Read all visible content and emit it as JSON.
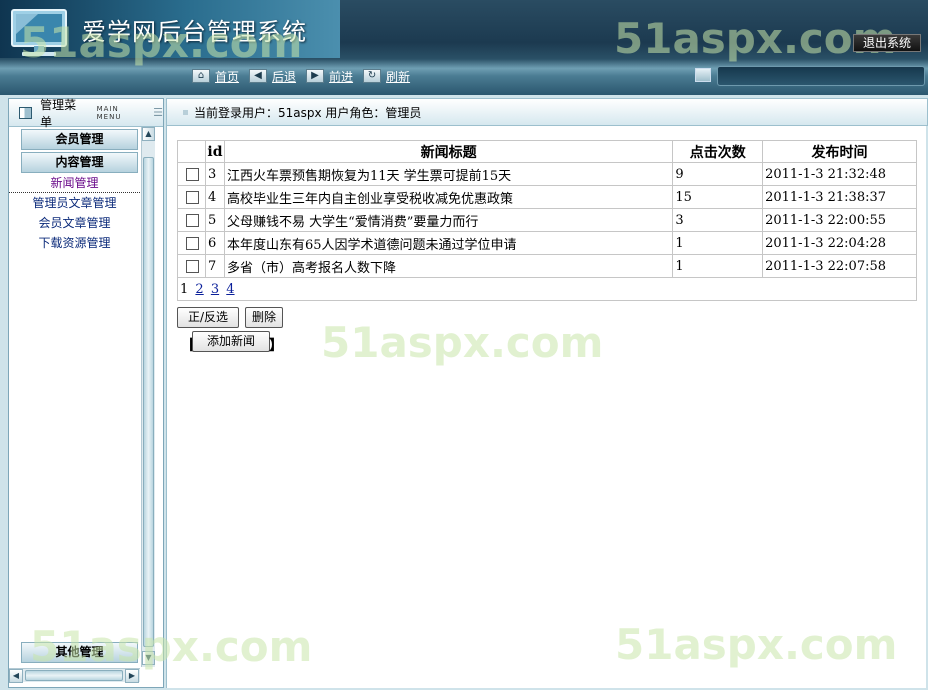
{
  "app": {
    "title": "爱学网后台管理系统",
    "exit_label": "退出系统"
  },
  "nav": [
    {
      "icon": "home-icon",
      "glyph": "⌂",
      "label": "首页"
    },
    {
      "icon": "back-icon",
      "glyph": "◀",
      "label": "后退"
    },
    {
      "icon": "forward-icon",
      "glyph": "▶",
      "label": "前进"
    },
    {
      "icon": "refresh-icon",
      "glyph": "↻",
      "label": "刷新"
    }
  ],
  "watermark": "51aspx.com",
  "sidebar": {
    "title": "管理菜单",
    "subtitle": "MAIN MENU",
    "categories": [
      {
        "label": "会员管理"
      },
      {
        "label": "内容管理"
      }
    ],
    "items": [
      {
        "label": "新闻管理"
      },
      {
        "label": "管理员文章管理"
      },
      {
        "label": "会员文章管理"
      },
      {
        "label": "下载资源管理"
      }
    ],
    "bottom_category": "其他管理"
  },
  "info": {
    "text": "当前登录用户：51aspx 用户角色：管理员"
  },
  "table": {
    "headers": [
      "",
      "id",
      "新闻标题",
      "点击次数",
      "发布时间"
    ],
    "rows": [
      {
        "id": "3",
        "title": "江西火车票预售期恢复为11天  学生票可提前15天",
        "clicks": "9",
        "time": "2011-1-3 21:32:48"
      },
      {
        "id": "4",
        "title": "高校毕业生三年内自主创业享受税收减免优惠政策",
        "clicks": "15",
        "time": "2011-1-3 21:38:37"
      },
      {
        "id": "5",
        "title": "父母赚钱不易  大学生“爱情消费”要量力而行",
        "clicks": "3",
        "time": "2011-1-3 22:00:55"
      },
      {
        "id": "6",
        "title": "本年度山东有65人因学术道德问题未通过学位申请",
        "clicks": "1",
        "time": "2011-1-3 22:04:28"
      },
      {
        "id": "7",
        "title": "多省（市）高考报名人数下降",
        "clicks": "1",
        "time": "2011-1-3 22:07:58"
      }
    ],
    "pages": [
      "1",
      "2",
      "3",
      "4"
    ]
  },
  "buttons": {
    "toggle_select": "正/反选",
    "delete": "删除",
    "add_news": "添加新闻",
    "bracket_left": "【",
    "bracket_right": "】"
  },
  "colors": {
    "header_dark": "#1c3a50",
    "panel_border": "#7ea6b8",
    "link": "#0a1f9a"
  }
}
